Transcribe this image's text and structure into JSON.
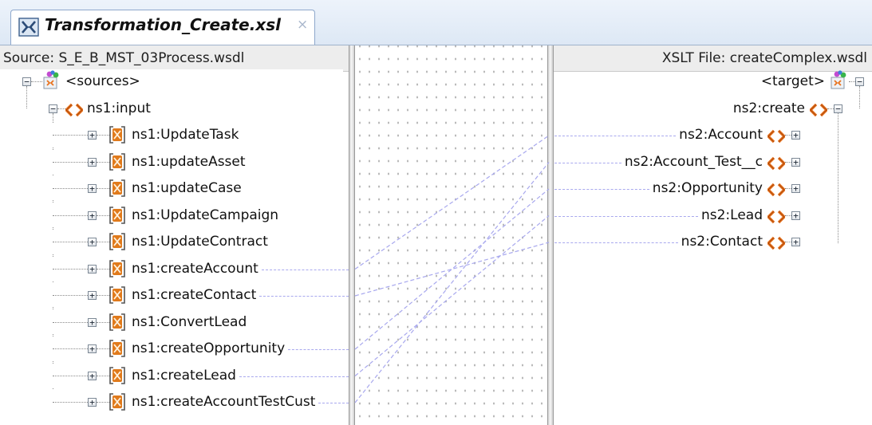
{
  "tab": {
    "title": "Transformation_Create.xsl",
    "close_glyph": "×",
    "icon": "xslt-map-icon"
  },
  "source": {
    "header": "Source: S_E_B_MST_03Process.wsdl",
    "root": {
      "label": "<sources>",
      "icon": "schema-node-icon",
      "expanded": true
    },
    "input": {
      "label": "ns1:input",
      "icon": "element-diamond-icon",
      "expanded": true
    },
    "items": [
      {
        "label": "ns1:UpdateTask",
        "mapped": false
      },
      {
        "label": "ns1:updateAsset",
        "mapped": false
      },
      {
        "label": "ns1:updateCase",
        "mapped": false
      },
      {
        "label": "ns1:UpdateCampaign",
        "mapped": false
      },
      {
        "label": "ns1:UpdateContract",
        "mapped": false
      },
      {
        "label": "ns1:createAccount",
        "mapped": true
      },
      {
        "label": "ns1:createContact",
        "mapped": true
      },
      {
        "label": "ns1:ConvertLead",
        "mapped": false
      },
      {
        "label": "ns1:createOpportunity",
        "mapped": true
      },
      {
        "label": "ns1:createLead",
        "mapped": true
      },
      {
        "label": "ns1:createAccountTestCust",
        "mapped": true
      }
    ]
  },
  "target": {
    "header": "XSLT File: createComplex.wsdl",
    "root": {
      "label": "<target>",
      "icon": "schema-node-icon",
      "expanded": true
    },
    "create": {
      "label": "ns2:create",
      "icon": "element-diamond-icon",
      "expanded": true
    },
    "items": [
      {
        "label": "ns2:Account",
        "mapped": true
      },
      {
        "label": "ns2:Account_Test__c",
        "mapped": true
      },
      {
        "label": "ns2:Opportunity",
        "mapped": true
      },
      {
        "label": "ns2:Lead",
        "mapped": true
      },
      {
        "label": "ns2:Contact",
        "mapped": true
      }
    ]
  },
  "mappings": [
    {
      "source": "ns1:createAccount",
      "target": "ns2:Account"
    },
    {
      "source": "ns1:createContact",
      "target": "ns2:Contact"
    },
    {
      "source": "ns1:createOpportunity",
      "target": "ns2:Opportunity"
    },
    {
      "source": "ns1:createLead",
      "target": "ns2:Lead"
    },
    {
      "source": "ns1:createAccountTestCust",
      "target": "ns2:Account_Test__c"
    }
  ],
  "colors": {
    "mapping_line": "#a8a8ee",
    "element_icon_orange": "#e8731f",
    "complex_icon_orange": "#e07a1c",
    "tab_bar": "#dde8f5"
  }
}
